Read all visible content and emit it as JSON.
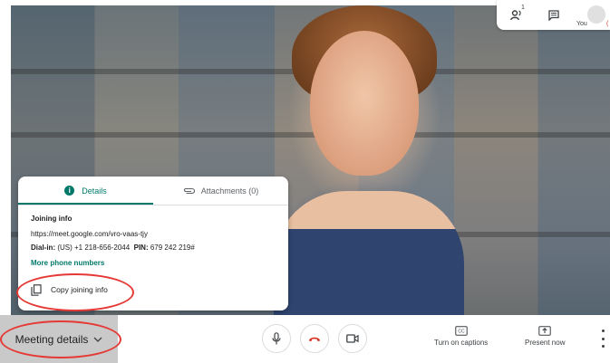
{
  "top_panel": {
    "people_count": "1",
    "self_label": "You",
    "self_label_overflow": "("
  },
  "details_card": {
    "tabs": [
      {
        "label": "Details",
        "icon": "info-icon",
        "active": true
      },
      {
        "label": "Attachments (0)",
        "icon": "paperclip-icon",
        "active": false
      }
    ],
    "joining_info_title": "Joining info",
    "meeting_url": "https://meet.google.com/vro-vaas-tjy",
    "dial_in_label": "Dial-in:",
    "dial_in_value": "(US) +1 218-656-2044",
    "pin_label": "PIN:",
    "pin_value": "679 242 219#",
    "more_phone_numbers": "More phone numbers",
    "copy_joining_info": "Copy joining info"
  },
  "bottom_bar": {
    "meeting_details_label": "Meeting details",
    "captions_label": "Turn on captions",
    "captions_icon_text": "CC",
    "present_label": "Present now"
  },
  "colors": {
    "accent": "#00796b",
    "annotation": "#e53935",
    "hangup": "#d93025"
  }
}
